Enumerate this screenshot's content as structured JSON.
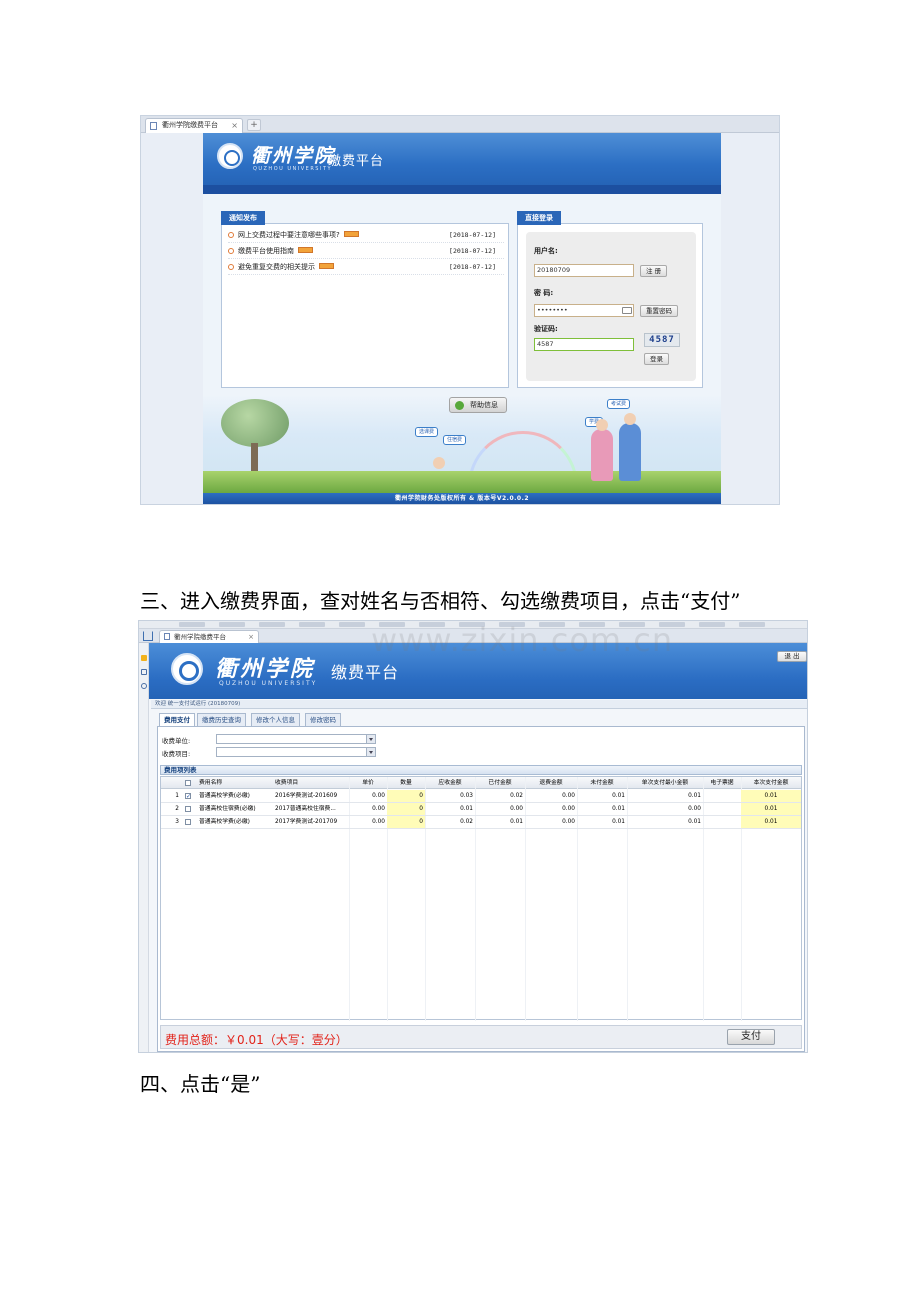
{
  "shot1": {
    "tab_title": "衢州学院缴费平台",
    "tab_close": "×",
    "tab_new": "+",
    "school_name": "衢州学院",
    "school_en": "QUZHOU UNIVERSITY",
    "platform": "缴费平台",
    "notice": {
      "title": "通知发布",
      "items": [
        {
          "text": "网上交费过程中要注意哪些事项?",
          "date": "[2018-07-12]"
        },
        {
          "text": "缴费平台使用指南",
          "date": "[2018-07-12]"
        },
        {
          "text": "避免重复交费的相关提示",
          "date": "[2018-07-12]"
        }
      ]
    },
    "login": {
      "title": "直接登录",
      "username_label": "用户名:",
      "username_value": "20180709",
      "register": "注 册",
      "password_label": "密 码:",
      "password_value": "••••••••",
      "reset": "重置密码",
      "captcha_label": "验证码:",
      "captcha_value": "4587",
      "captcha_image": "4587",
      "login_btn": "登录"
    },
    "help": "帮助信息",
    "bubbles": [
      "考试费",
      "学费",
      "住宿费",
      "选课费"
    ],
    "footer": "衢州学院财务处版权所有 & 版本号V2.0.0.2"
  },
  "caption3": "三、进入缴费界面，查对姓名与否相符、勾选缴费项目，点击“支付”",
  "shot2": {
    "watermark": "www.zixin.com.cn",
    "tab_title": "衢州学院缴费平台",
    "tab_close": "×",
    "school_name": "衢州学院",
    "school_en": "QUZHOU UNIVERSITY",
    "platform": "缴费平台",
    "logout": "退 出",
    "welcome": "欢迎 统一支付试运行 (20180709)",
    "tabs": [
      "费用支付",
      "缴费历史查询",
      "修改个人信息",
      "修改密码"
    ],
    "unit_label": "收费单位:",
    "item_label": "收费项目:",
    "grid_title": "费用项列表",
    "columns": [
      "费用名称",
      "收费项目",
      "单价",
      "数量",
      "应收金额",
      "已付金额",
      "退费金额",
      "未付金额",
      "单次支付最小金额",
      "电子票据",
      "本次支付金额"
    ],
    "rows": [
      {
        "no": "1",
        "checked": "✓",
        "name": "普通高校学费(必缴)",
        "item": "2016学费测试-201609",
        "price": "0.00",
        "qty": "0",
        "due": "0.03",
        "paid": "0.02",
        "refund": "0.00",
        "unpaid": "0.01",
        "min": "0.01",
        "receipt": "",
        "pay": "0.01"
      },
      {
        "no": "2",
        "checked": "",
        "name": "普通高校住宿费(必缴)",
        "item": "2017普通高校住宿费...",
        "price": "0.00",
        "qty": "0",
        "due": "0.01",
        "paid": "0.00",
        "refund": "0.00",
        "unpaid": "0.01",
        "min": "0.00",
        "receipt": "",
        "pay": "0.01"
      },
      {
        "no": "3",
        "checked": "",
        "name": "普通高校学费(必缴)",
        "item": "2017学费测试-201709",
        "price": "0.00",
        "qty": "0",
        "due": "0.02",
        "paid": "0.01",
        "refund": "0.00",
        "unpaid": "0.01",
        "min": "0.01",
        "receipt": "",
        "pay": "0.01"
      }
    ],
    "total": "费用总额：￥0.01（大写：壹分）",
    "pay_btn": "支付"
  },
  "caption4": "四、点击“是”"
}
